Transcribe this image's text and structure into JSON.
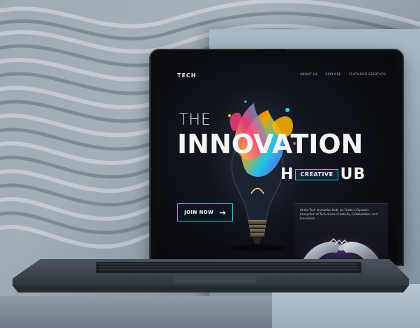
{
  "site": {
    "logo": "TECH",
    "nav": [
      "ABOUT US",
      "EXPLORE",
      "FEATURED STARTUPS"
    ],
    "hero": {
      "line1": "THE",
      "line2": "INNOVATION",
      "hub_letter": "H",
      "badge": "CREATIVE",
      "hub_rest": "UB"
    },
    "cta": {
      "label": "JOIN NOW",
      "arrow": "→"
    },
    "description": "At the Tech Innovation Hub, we Foster a Dynamic Ecosystem of Tech-driven Creativity, Collaboration, and Innovation."
  },
  "colors": {
    "accent": "#3cc8e0",
    "screen_bg": "#0c0e14",
    "text": "#f4f4f4",
    "backdrop": "#8f9fab"
  },
  "icons": {
    "cta_arrow": "arrow-right-icon",
    "hero_image": "lightbulb-icon",
    "card_image": "robot-hands-icon"
  }
}
